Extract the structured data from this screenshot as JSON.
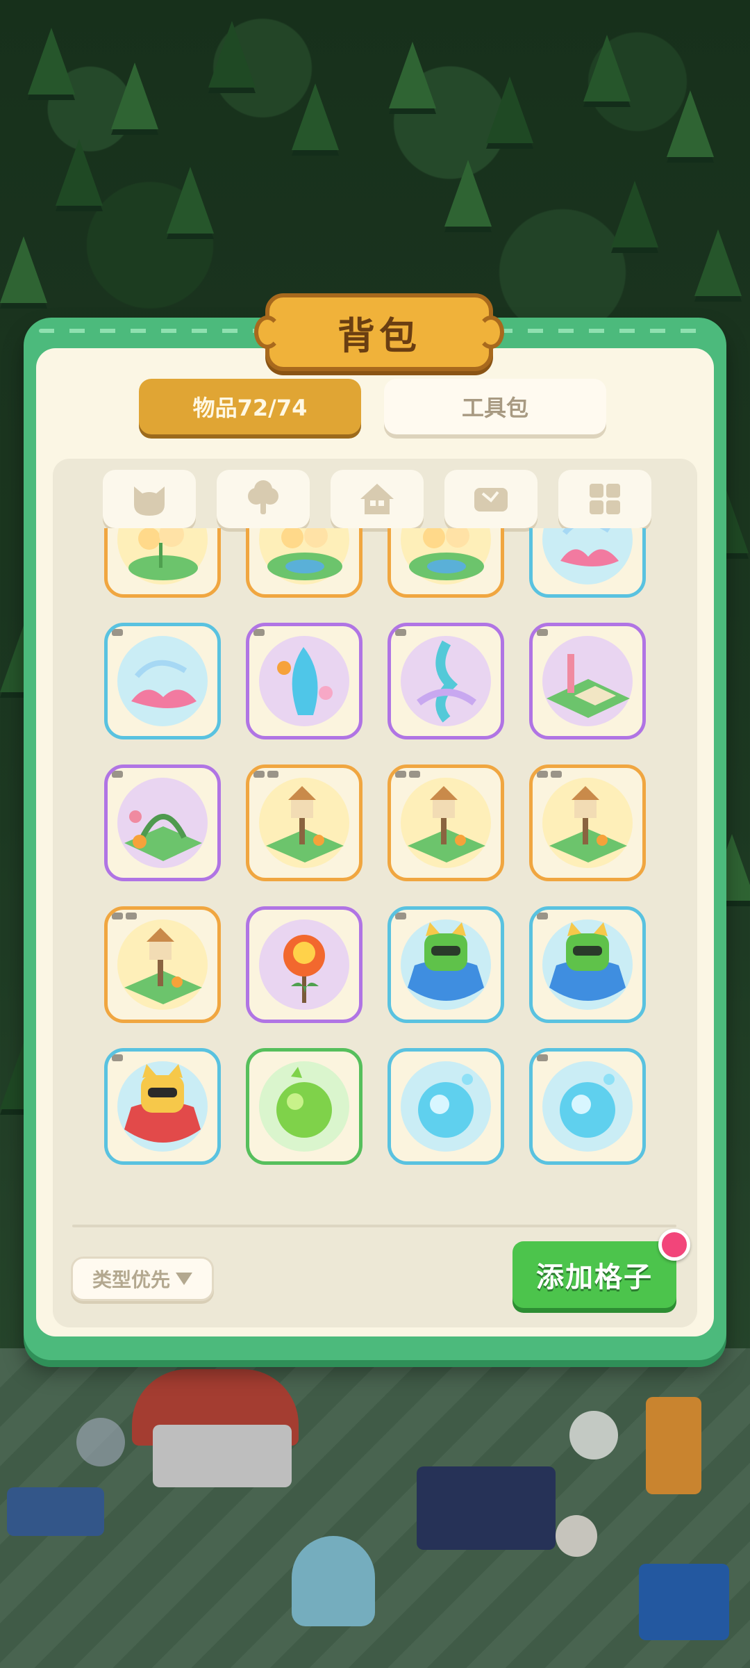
{
  "panel": {
    "title": "背包",
    "tabs": [
      {
        "label": "物品72/74",
        "active": true
      },
      {
        "label": "工具包",
        "active": false
      }
    ]
  },
  "filters": [
    {
      "icon": "cat-icon"
    },
    {
      "icon": "tree-icon"
    },
    {
      "icon": "house-icon"
    },
    {
      "icon": "map-icon"
    },
    {
      "icon": "grid-icon"
    }
  ],
  "items": [
    {
      "name": "flower-pond-decoration",
      "rarity": "orange"
    },
    {
      "name": "flower-pond-decoration",
      "rarity": "orange"
    },
    {
      "name": "flower-pond-decoration",
      "rarity": "orange"
    },
    {
      "name": "coral-shell-decoration",
      "rarity": "blue"
    },
    {
      "name": "coral-shell-decoration",
      "rarity": "blue"
    },
    {
      "name": "water-fountain-decoration",
      "rarity": "purple"
    },
    {
      "name": "magic-fountain-decoration",
      "rarity": "purple"
    },
    {
      "name": "garden-plot-decoration",
      "rarity": "purple"
    },
    {
      "name": "flower-arch-decoration",
      "rarity": "purple"
    },
    {
      "name": "birdhouse-garden-decoration",
      "rarity": "orange"
    },
    {
      "name": "birdhouse-garden-decoration",
      "rarity": "orange"
    },
    {
      "name": "birdhouse-garden-decoration",
      "rarity": "orange"
    },
    {
      "name": "birdhouse-garden-decoration",
      "rarity": "orange"
    },
    {
      "name": "fire-flower-decoration",
      "rarity": "purple"
    },
    {
      "name": "robot-cat-bed-green",
      "rarity": "blue"
    },
    {
      "name": "robot-cat-bed-green",
      "rarity": "blue"
    },
    {
      "name": "robot-cat-bed-yellow",
      "rarity": "blue"
    },
    {
      "name": "green-orb",
      "rarity": "green"
    },
    {
      "name": "blue-orb",
      "rarity": "blue"
    },
    {
      "name": "blue-orb",
      "rarity": "blue"
    }
  ],
  "footer": {
    "sort_label": "类型优先",
    "add_label": "添加格子"
  },
  "colors": {
    "panel_green": "#4cba7c",
    "tab_active": "#e0a534",
    "rarity_orange": "#f0a640",
    "rarity_blue": "#59c2e0",
    "rarity_purple": "#b074e4",
    "rarity_green": "#56bf5c",
    "add_button": "#4cc44c",
    "notification_dot": "#f2457a"
  }
}
